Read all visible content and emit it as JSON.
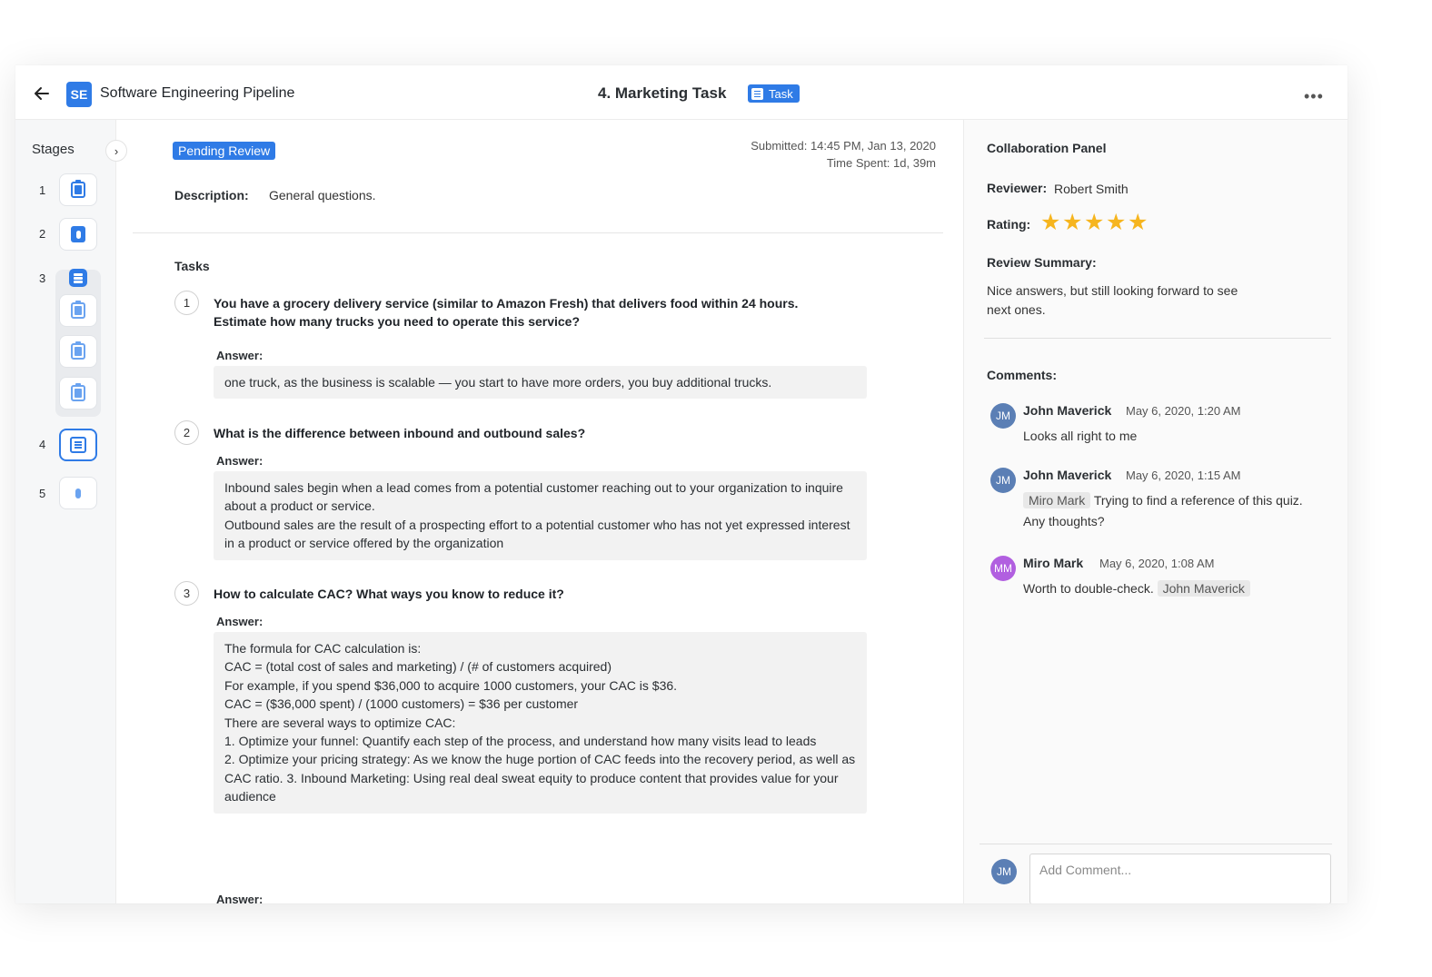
{
  "header": {
    "project_initials": "SE",
    "project_title": "Software Engineering Pipeline",
    "task_title": "4. Marketing Task",
    "task_badge": "Task",
    "more_label": "•••"
  },
  "stages": {
    "title": "Stages",
    "toggle": "›",
    "items": [
      {
        "num": "1",
        "icon": "clipboard-icon"
      },
      {
        "num": "2",
        "icon": "microphone-icon"
      },
      {
        "num": "3",
        "icon": "layers-icon"
      },
      {
        "num": "4",
        "icon": "document-icon",
        "active": true
      },
      {
        "num": "5",
        "icon": "microphone-icon"
      }
    ]
  },
  "main": {
    "status": "Pending Review",
    "submitted": "Submitted: 14:45 PM, Jan 13, 2020",
    "time_spent": "Time Spent:  1d, 39m",
    "description_label": "Description:",
    "description": "General questions.",
    "tasks_label": "Tasks",
    "answer_label": "Answer:",
    "questions": [
      {
        "num": "1",
        "text": "You have a grocery delivery service (similar to Amazon Fresh) that delivers food within 24 hours. Estimate how many trucks you need to operate this service?",
        "answer": [
          "one truck, as the business is scalable — you start to have more orders, you buy additional trucks."
        ]
      },
      {
        "num": "2",
        "text": "What is the difference between inbound and outbound sales?",
        "answer": [
          "Inbound sales begin when a lead comes from a potential customer reaching out to your organization to inquire about a product or service.",
          "Outbound sales are the result of a prospecting effort to a potential customer who has not yet expressed interest in a product or service offered by the organization"
        ]
      },
      {
        "num": "3",
        "text": "How to calculate CAC? What ways you know to reduce it?",
        "answer": [
          "The formula for CAC calculation is:",
          "CAC = (total cost of sales and marketing) / (# of customers acquired)",
          "For example, if you spend $36,000 to acquire 1000 customers, your CAC is $36.",
          "CAC = ($36,000 spent) / (1000 customers) = $36 per customer",
          "There are several ways to optimize CAC:",
          "1. Optimize your funnel: Quantify each step of the process, and understand how many visits lead to leads",
          "2. Optimize your pricing strategy: As we know the huge portion of CAC feeds into the recovery period, as well as CAC ratio. 3. Inbound Marketing: Using real deal sweat equity to produce content that provides value for your audience"
        ]
      }
    ]
  },
  "collab": {
    "title": "Collaboration Panel",
    "reviewer_label": "Reviewer:",
    "reviewer": "Robert Smith",
    "rating_label": "Rating:",
    "rating": 5,
    "rating_max": 5,
    "summary_label": "Review Summary:",
    "summary": "Nice answers, but still looking forward to see next ones.",
    "comments_label": "Comments:",
    "comments": [
      {
        "initials": "JM",
        "author": "John Maverick",
        "time": "May 6, 2020, 1:20 AM",
        "mention_before": "",
        "text": "Looks all right to me",
        "mention_after": ""
      },
      {
        "initials": "JM",
        "author": "John Maverick",
        "time": "May 6, 2020, 1:15 AM",
        "mention_before": "Miro Mark",
        "text": "Trying to find a reference of this quiz. Any thoughts?",
        "mention_after": ""
      },
      {
        "initials": "MM",
        "author": "Miro Mark",
        "time": "May 6, 2020, 1:08 AM",
        "mention_before": "",
        "text": "Worth to double-check.",
        "mention_after": "John Maverick"
      }
    ],
    "input_avatar": "JM",
    "input_placeholder": "Add Comment..."
  },
  "colors": {
    "accent": "#2f7be6",
    "star": "#f6b51e",
    "avatar_jm": "#5b7fb5",
    "avatar_mm": "#b15fe0"
  }
}
